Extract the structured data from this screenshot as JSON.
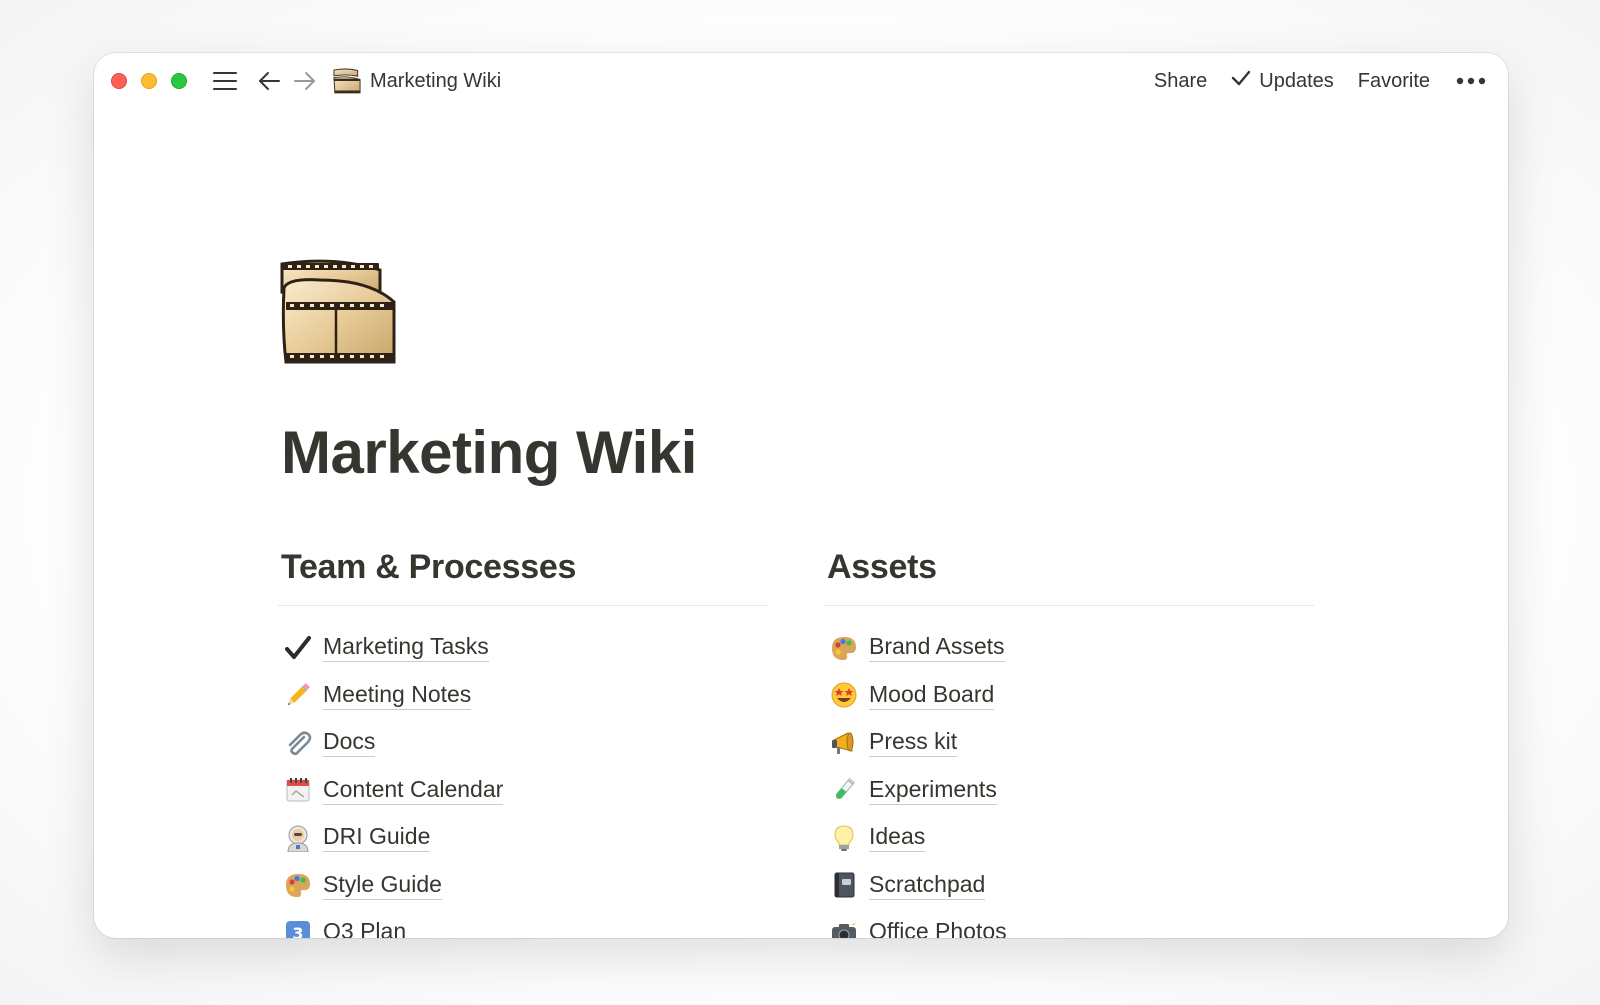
{
  "window": {
    "breadcrumb_title": "Marketing Wiki",
    "breadcrumb_icon": "film-strip-icon",
    "actions": {
      "share": "Share",
      "updates": "Updates",
      "favorite": "Favorite"
    }
  },
  "page": {
    "icon": "film-strip-icon",
    "title": "Marketing Wiki"
  },
  "columns": {
    "left": {
      "heading": "Team & Processes",
      "items": [
        {
          "label": "Marketing Tasks",
          "icon": "check-mark-icon"
        },
        {
          "label": "Meeting Notes",
          "icon": "pencil-icon"
        },
        {
          "label": "Docs",
          "icon": "paperclip-icon"
        },
        {
          "label": "Content Calendar",
          "icon": "calendar-icon"
        },
        {
          "label": "DRI Guide",
          "icon": "astronaut-icon"
        },
        {
          "label": "Style Guide",
          "icon": "palette-icon"
        },
        {
          "label": "Q3 Plan",
          "icon": "number-3-icon"
        }
      ]
    },
    "right": {
      "heading": "Assets",
      "items": [
        {
          "label": "Brand Assets",
          "icon": "palette-icon"
        },
        {
          "label": "Mood Board",
          "icon": "star-struck-icon"
        },
        {
          "label": "Press kit",
          "icon": "megaphone-icon"
        },
        {
          "label": "Experiments",
          "icon": "test-tube-icon"
        },
        {
          "label": "Ideas",
          "icon": "light-bulb-icon"
        },
        {
          "label": "Scratchpad",
          "icon": "notebook-icon"
        },
        {
          "label": "Office Photos",
          "icon": "camera-flash-icon"
        }
      ]
    }
  },
  "colors": {
    "text": "#37352f",
    "traffic_red": "#ff5f57",
    "traffic_yellow": "#febc2e",
    "traffic_green": "#28c840",
    "divider": "#e9e9e7"
  }
}
